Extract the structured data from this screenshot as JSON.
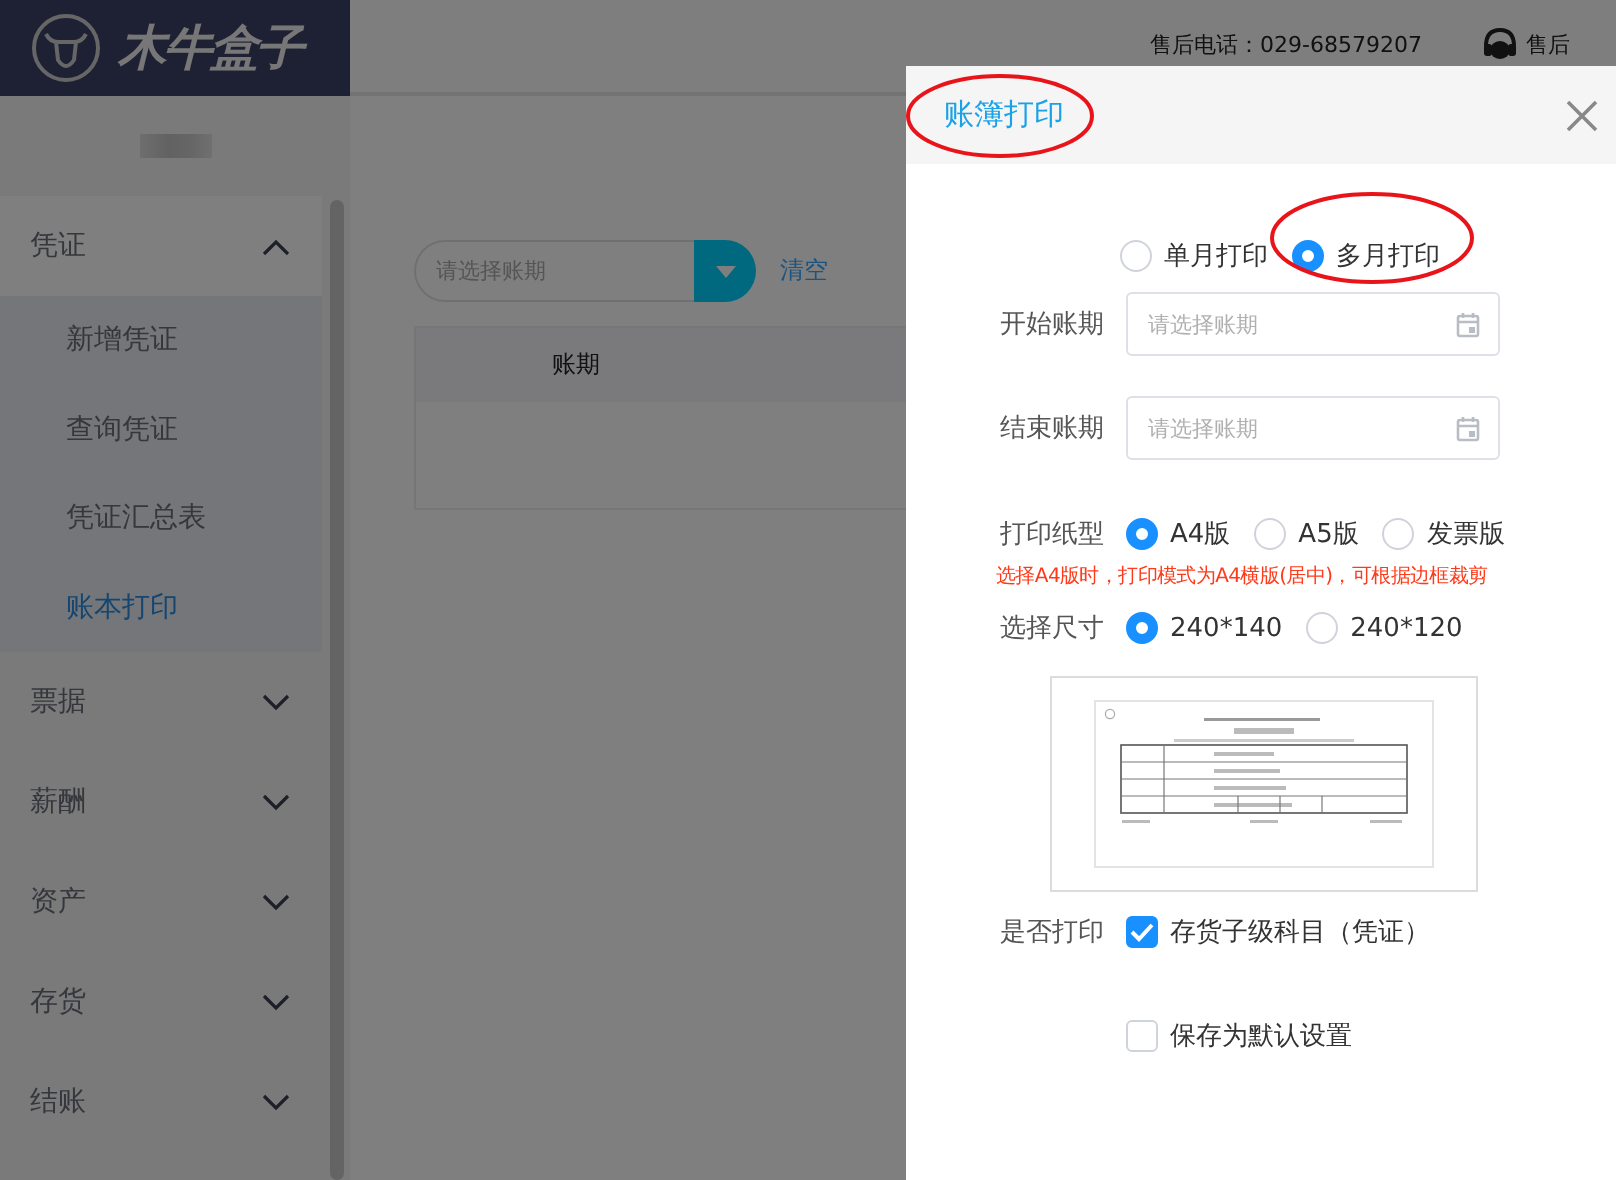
{
  "logo": {
    "text": "木牛盒子"
  },
  "header": {
    "phone": "售后电话：029-68579207",
    "service": "售后"
  },
  "sidebar": {
    "items": [
      {
        "label": "凭证",
        "expanded": true,
        "children": [
          {
            "label": "新增凭证",
            "selected": false
          },
          {
            "label": "查询凭证",
            "selected": false
          },
          {
            "label": "凭证汇总表",
            "selected": false
          },
          {
            "label": "账本打印",
            "selected": true
          }
        ]
      },
      {
        "label": "票据",
        "expanded": false
      },
      {
        "label": "薪酬",
        "expanded": false
      },
      {
        "label": "资产",
        "expanded": false
      },
      {
        "label": "存货",
        "expanded": false
      },
      {
        "label": "结账",
        "expanded": false
      }
    ]
  },
  "filter": {
    "placeholder": "请选择账期",
    "clear": "清空"
  },
  "table": {
    "columns": [
      "账期"
    ]
  },
  "dialog": {
    "title": "账簿打印",
    "modes": [
      {
        "label": "单月打印",
        "selected": false
      },
      {
        "label": "多月打印",
        "selected": true
      }
    ],
    "fields": [
      {
        "label": "开始账期",
        "placeholder": "请选择账期"
      },
      {
        "label": "结束账期",
        "placeholder": "请选择账期"
      }
    ],
    "paper": {
      "label": "打印纸型",
      "options": [
        {
          "label": "A4版",
          "selected": true
        },
        {
          "label": "A5版",
          "selected": false
        },
        {
          "label": "发票版",
          "selected": false
        }
      ]
    },
    "note": "选择A4版时，打印模式为A4横版(居中)，可根据边框裁剪",
    "size": {
      "label": "选择尺寸",
      "options": [
        {
          "label": "240*140",
          "selected": true
        },
        {
          "label": "240*120",
          "selected": false
        }
      ]
    },
    "print": {
      "label": "是否打印",
      "text": "存货子级科目（凭证）",
      "checked": true
    },
    "save_default": {
      "text": "保存为默认设置",
      "checked": false
    }
  }
}
